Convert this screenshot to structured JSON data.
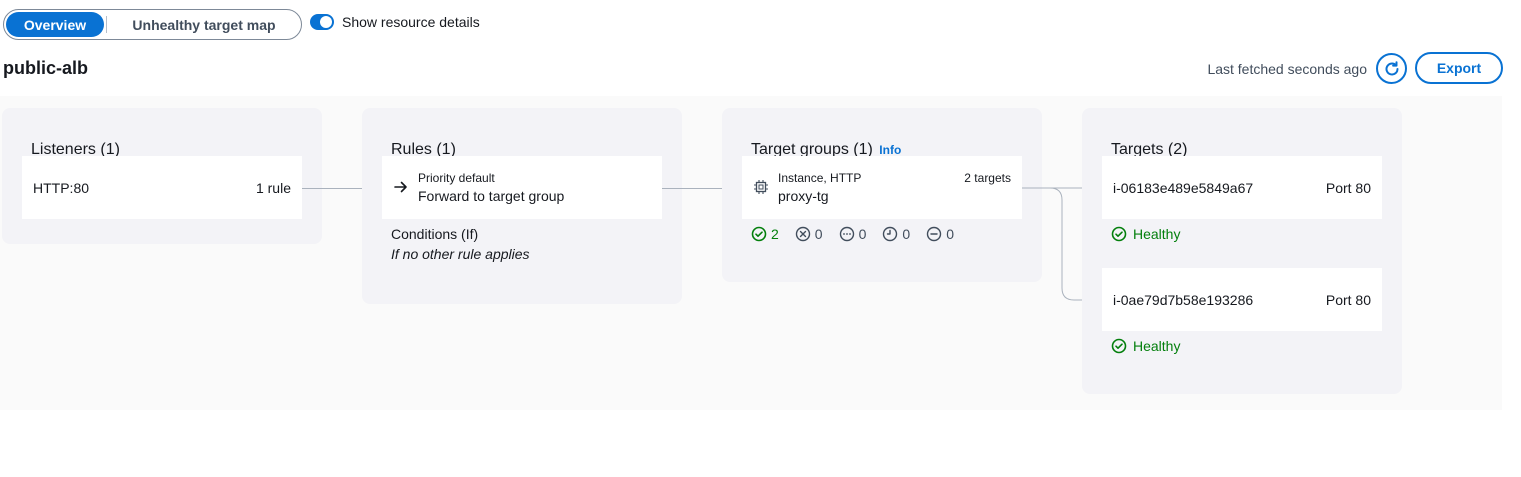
{
  "tabs": {
    "overview": "Overview",
    "unhealthy": "Unhealthy target map"
  },
  "toggle": {
    "label": "Show resource details",
    "checked": true
  },
  "load_balancer": {
    "name": "public-alb"
  },
  "header_actions": {
    "fetched": "Last fetched seconds ago",
    "export": "Export"
  },
  "listeners": {
    "title": "Listeners (1)",
    "items": [
      {
        "protocol": "HTTP:80",
        "rules": "1 rule"
      }
    ]
  },
  "rules": {
    "title": "Rules (1)",
    "items": [
      {
        "priority": "Priority default",
        "action": "Forward to target group"
      }
    ],
    "conditions_label": "Conditions (If)",
    "conditions_value": "If no other rule applies"
  },
  "target_groups": {
    "title": "Target groups (1)",
    "info": "Info",
    "items": [
      {
        "type": "Instance, HTTP",
        "count": "2 targets",
        "name": "proxy-tg",
        "status_counts": {
          "healthy": "2",
          "unhealthy": "0",
          "pending": "0",
          "draining": "0",
          "unused": "0"
        }
      }
    ]
  },
  "targets": {
    "title": "Targets (2)",
    "items": [
      {
        "id": "i-06183e489e5849a67",
        "port": "Port 80",
        "health": "Healthy"
      },
      {
        "id": "i-0ae79d7b58e193286",
        "port": "Port 80",
        "health": "Healthy"
      }
    ]
  },
  "colors": {
    "accent": "#0972d3",
    "healthy": "#037f0c",
    "column_bg": "#f3f3f7"
  }
}
